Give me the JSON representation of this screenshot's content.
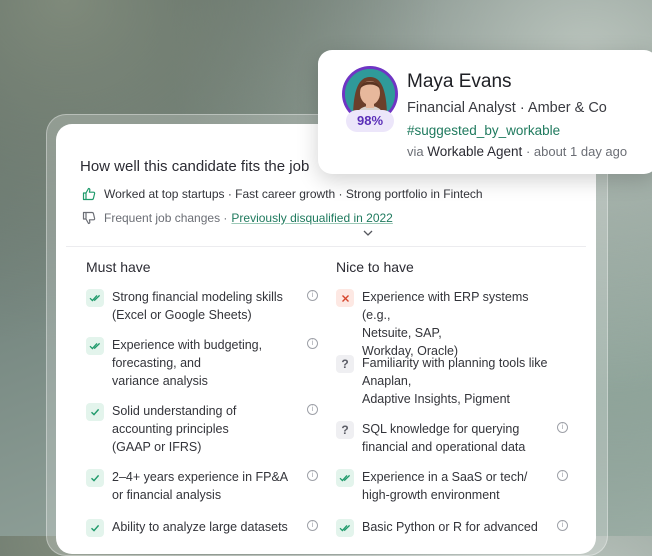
{
  "fit": {
    "title": "How well this candidate fits the job",
    "positives": "Worked at top startups · Fast career growth · Strong portfolio in Fintech",
    "negatives_prefix": "Frequent job changes ·",
    "negatives_link": "Previously disqualified in 2022"
  },
  "must_have": {
    "title": "Must have",
    "items": [
      {
        "status": "check-double",
        "text": "Strong financial modeling skills\n(Excel or Google Sheets)"
      },
      {
        "status": "check-double",
        "text": "Experience with budgeting,\nforecasting, and\nvariance analysis"
      },
      {
        "status": "check",
        "text": "Solid understanding of\naccounting principles\n(GAAP or IFRS)"
      },
      {
        "status": "check",
        "text": "2–4+ years experience in FP&A\nor financial analysis"
      },
      {
        "status": "check",
        "text": "Ability to analyze large datasets"
      }
    ]
  },
  "nice_to_have": {
    "title": "Nice to have",
    "items": [
      {
        "status": "cross",
        "text": "Experience with ERP systems (e.g.,\nNetsuite, SAP,\nWorkday, Oracle)"
      },
      {
        "status": "question",
        "text": "Familiarity with planning tools like\nAnaplan,\nAdaptive Insights, Pigment"
      },
      {
        "status": "question",
        "text": "SQL knowledge for querying\nfinancial and operational data"
      },
      {
        "status": "check-double",
        "text": "Experience in a SaaS or tech/\nhigh-growth environment"
      },
      {
        "status": "check-double",
        "text": "Basic Python or R for advanced"
      }
    ]
  },
  "profile": {
    "name": "Maya Evans",
    "role": "Financial Analyst · Amber & Co",
    "tag": "#suggested_by_workable",
    "via_prefix": "via",
    "via_agent": "Workable Agent",
    "via_suffix": "· about 1 day ago",
    "score": "98%"
  },
  "colors": {
    "accent_green": "#1f9a6b",
    "accent_purple": "#6f35c4",
    "error_red": "#d6452c"
  },
  "icons": {
    "thumbs_up": "thumbs-up-icon",
    "thumbs_down": "thumbs-down-icon",
    "chevron": "chevron-down-icon",
    "info": "info-icon"
  }
}
